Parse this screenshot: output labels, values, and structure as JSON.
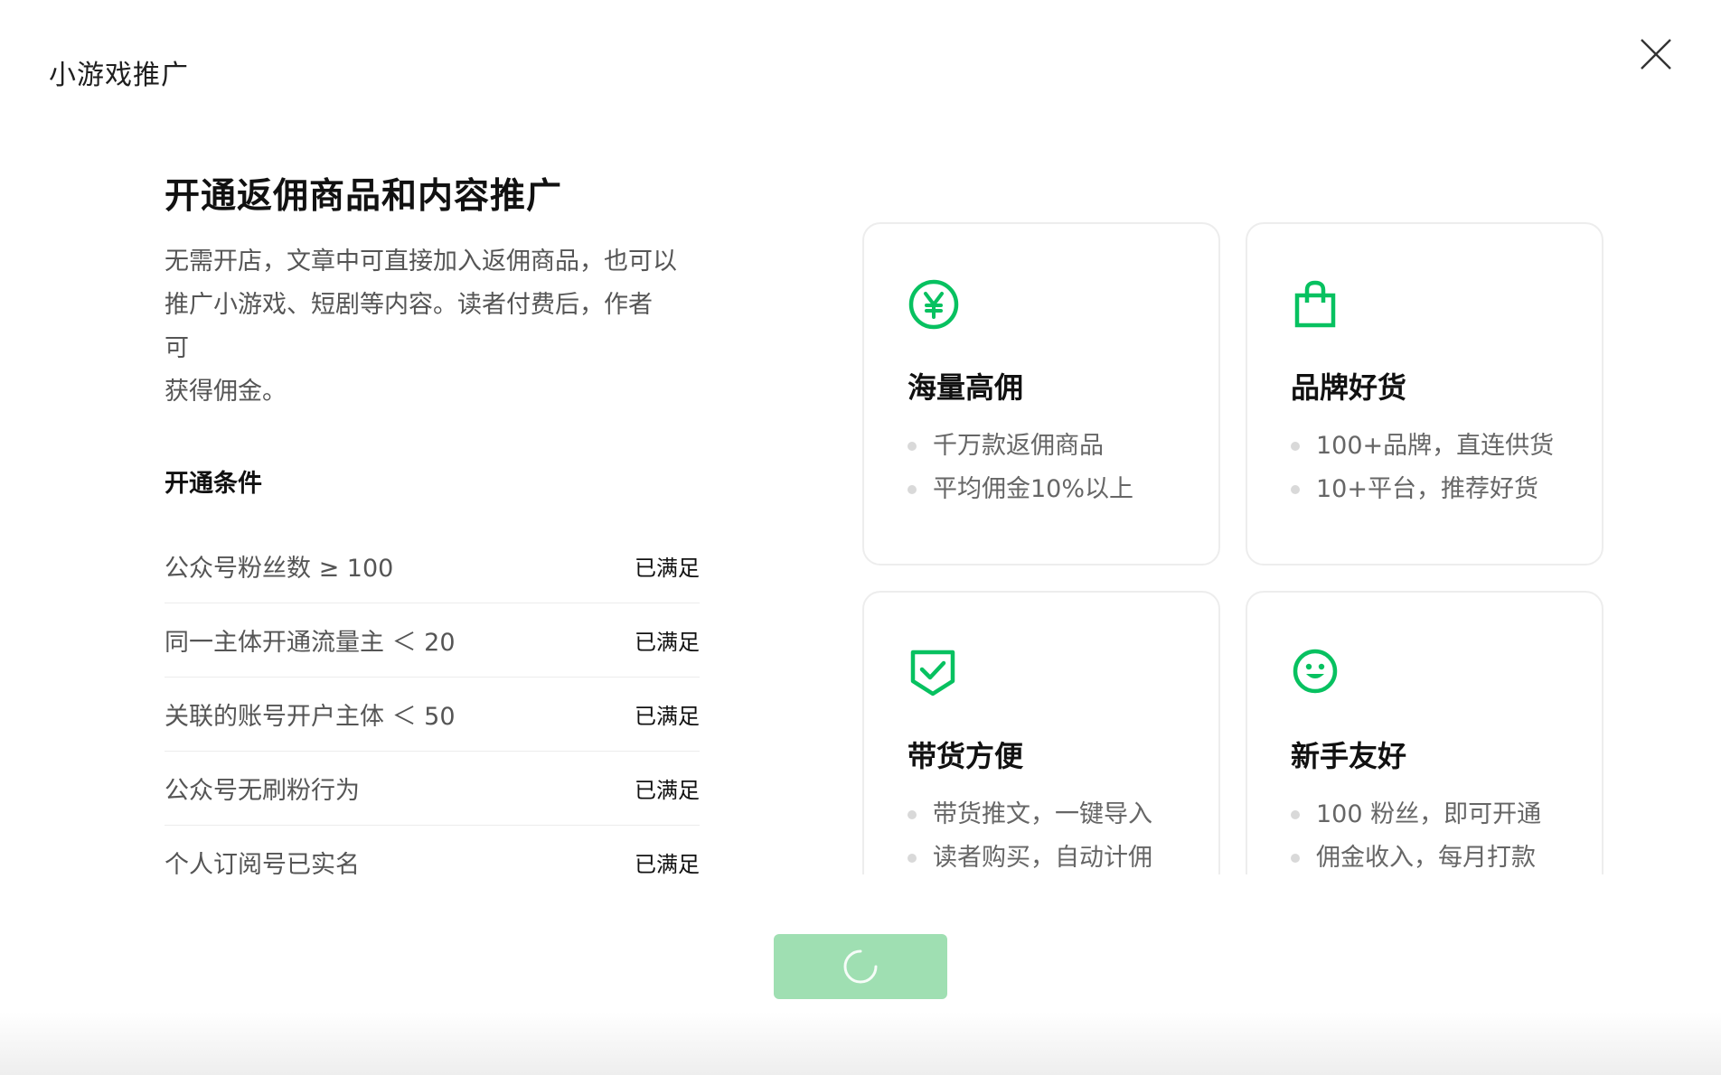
{
  "dialog": {
    "title": "小游戏推广",
    "close_icon": "close-icon"
  },
  "intro": {
    "headline": "开通返佣商品和内容推广",
    "description_lines": [
      "无需开店，文章中可直接加入返佣商品，也可以",
      "推广小游戏、短剧等内容。读者付费后，作者",
      "可",
      "获得佣金。"
    ]
  },
  "conditions": {
    "title": "开通条件",
    "rows": [
      {
        "label": "公众号粉丝数 ≥ 100",
        "status": "已满足"
      },
      {
        "label": "同一主体开通流量主 ＜ 20",
        "status": "已满足"
      },
      {
        "label": "关联的账号开户主体 ＜ 50",
        "status": "已满足"
      },
      {
        "label": "公众号无刷粉行为",
        "status": "已满足"
      },
      {
        "label": "个人订阅号已实名",
        "status": "已满足"
      }
    ]
  },
  "cards": [
    {
      "icon": "yuan-coin-icon",
      "title": "海量高佣",
      "points": [
        "千万款返佣商品",
        "平均佣金10%以上"
      ]
    },
    {
      "icon": "shopping-bag-icon",
      "title": "品牌好货",
      "points": [
        "100+品牌，直连供货",
        "10+平台，推荐好货"
      ]
    },
    {
      "icon": "shield-check-icon",
      "title": "带货方便",
      "points": [
        "带货推文，一键导入",
        "读者购买，自动计佣"
      ]
    },
    {
      "icon": "smile-icon",
      "title": "新手友好",
      "points": [
        "100 粉丝，即可开通",
        "佣金收入，每月打款"
      ]
    }
  ],
  "colors": {
    "accent": "#07c160",
    "button_loading": "#9fdfb2",
    "muted_text": "#555555"
  },
  "primary_button": {
    "state": "loading",
    "icon": "loading-spinner-icon"
  }
}
